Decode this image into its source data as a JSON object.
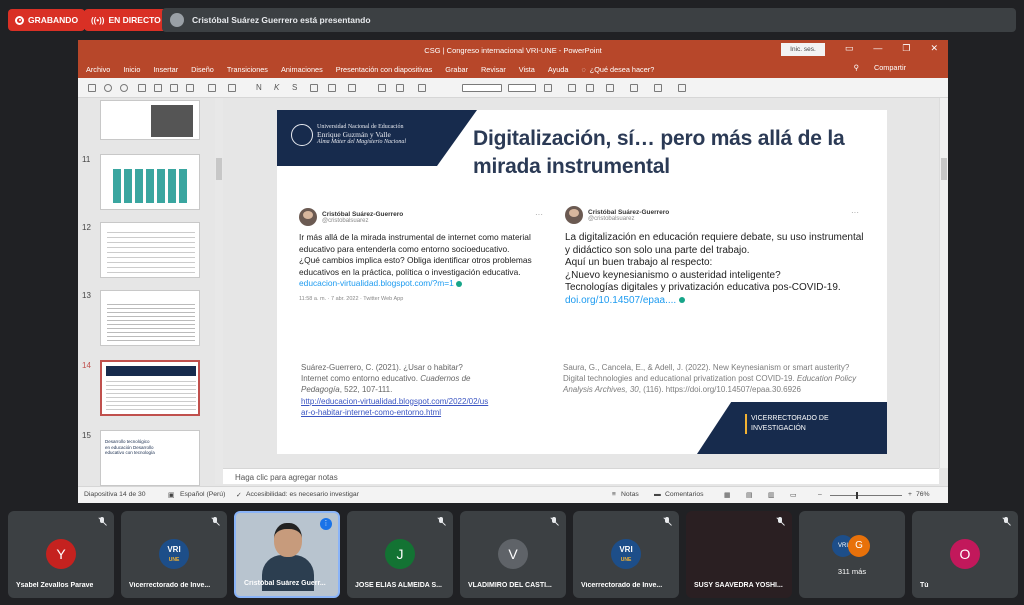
{
  "meet": {
    "recording_label": "GRABANDO",
    "live_label": "EN DIRECTO",
    "presenting_text": "Cristóbal Suárez Guerrero está presentando"
  },
  "ppt": {
    "window_title": "CSG | Congreso internacional VRI-UNE  -  PowerPoint",
    "signin_label": "Inic. ses.",
    "menu": [
      "Archivo",
      "Inicio",
      "Insertar",
      "Diseño",
      "Transiciones",
      "Animaciones",
      "Presentación con diapositivas",
      "Grabar",
      "Revisar",
      "Vista",
      "Ayuda",
      "¿Qué desea hacer?"
    ],
    "share_label": "Compartir",
    "thumb_numbers": [
      "11",
      "12",
      "13",
      "14",
      "15"
    ],
    "thumb_15_text": "Desarrollo tecnológico en educación Desarrollo educativo con tecnología",
    "slide": {
      "university_lines": [
        "Universidad Nacional de Educación",
        "Enrique Guzmán y Valle",
        "Alma Máter del Magisterio Nacional"
      ],
      "title": "Digitalización, sí… pero más allá de la mirada instrumental",
      "tweet1": {
        "name": "Cristóbal Suárez-Guerrero",
        "handle": "@cristobalsuarez",
        "body": "Ir más allá de la mirada instrumental de internet como material educativo para entenderla como entorno socioeducativo.\n¿Qué cambios implica esto? Obliga identificar otros problemas educativos en la práctica, política o investigación educativa.",
        "link": "educacion-virtualidad.blogspot.com/?m=1",
        "meta": "11:58 a. m. · 7 abr. 2022 · Twitter Web App"
      },
      "tweet2": {
        "name": "Cristóbal Suárez-Guerrero",
        "handle": "@cristobalsuarez",
        "body": "La digitalización en educación requiere debate, su uso instrumental y didáctico son solo una parte del trabajo.\nAquí un buen trabajo al respecto:\n¿Nuevo keynesianismo o austeridad inteligente?\nTecnologías digitales y privatización educativa pos-COVID-19.",
        "link": "doi.org/10.14507/epaa...."
      },
      "ref1": {
        "text": "Suárez-Guerrero, C. (2021). ¿Usar o habitar? Internet como entorno educativo.",
        "journal": "Cuadernos de Pedagogía",
        "rest": ", 522, 107-111.",
        "url": "http://educacion-virtualidad.blogspot.com/2022/02/usar-o-habitar-internet-como-entorno.html"
      },
      "ref2": {
        "text": "Saura, G., Cancela, E., & Adell, J. (2022). New Keynesianism or smart austerity? Digital technologies and educational privatization post COVID-19.",
        "journal": "Education Policy Analysis Archives, 30",
        "rest": ", (116). https://doi.org/10.14507/epaa.30.6926"
      },
      "vicerrectorado": [
        "VICERRECTORADO DE",
        "INVESTIGACIÓN"
      ]
    },
    "notes_placeholder": "Haga clic para agregar notas",
    "status": {
      "slide_of": "Diapositiva 14 de 30",
      "language": "Español (Perú)",
      "accessibility": "Accesibilidad: es necesario investigar",
      "notes": "Notas",
      "comments": "Comentarios",
      "zoom": "76%"
    }
  },
  "participants": [
    {
      "initial": "Y",
      "name": "Ysabel Zevallos Parave",
      "color": "#c5221f"
    },
    {
      "logo": "VRI",
      "logo_sub": "UNE",
      "name": "Vicerrectorado de Inve..."
    },
    {
      "name": "Cristóbal Suárez Guerr..."
    },
    {
      "initial": "J",
      "name": "JOSE ELIAS ALMEIDA S...",
      "color": "#137333"
    },
    {
      "initial": "V",
      "name": "VLADIMIRO DEL CASTI...",
      "color": "#5f6368"
    },
    {
      "logo": "VRI",
      "logo_sub": "UNE",
      "name": "Vicerrectorado de Inve..."
    },
    {
      "name": "SUSY SAAVEDRA YOSHI..."
    },
    {
      "count": "311 más",
      "initial": "G"
    },
    {
      "initial": "O",
      "name": "Tú",
      "color": "#c2185b"
    }
  ]
}
